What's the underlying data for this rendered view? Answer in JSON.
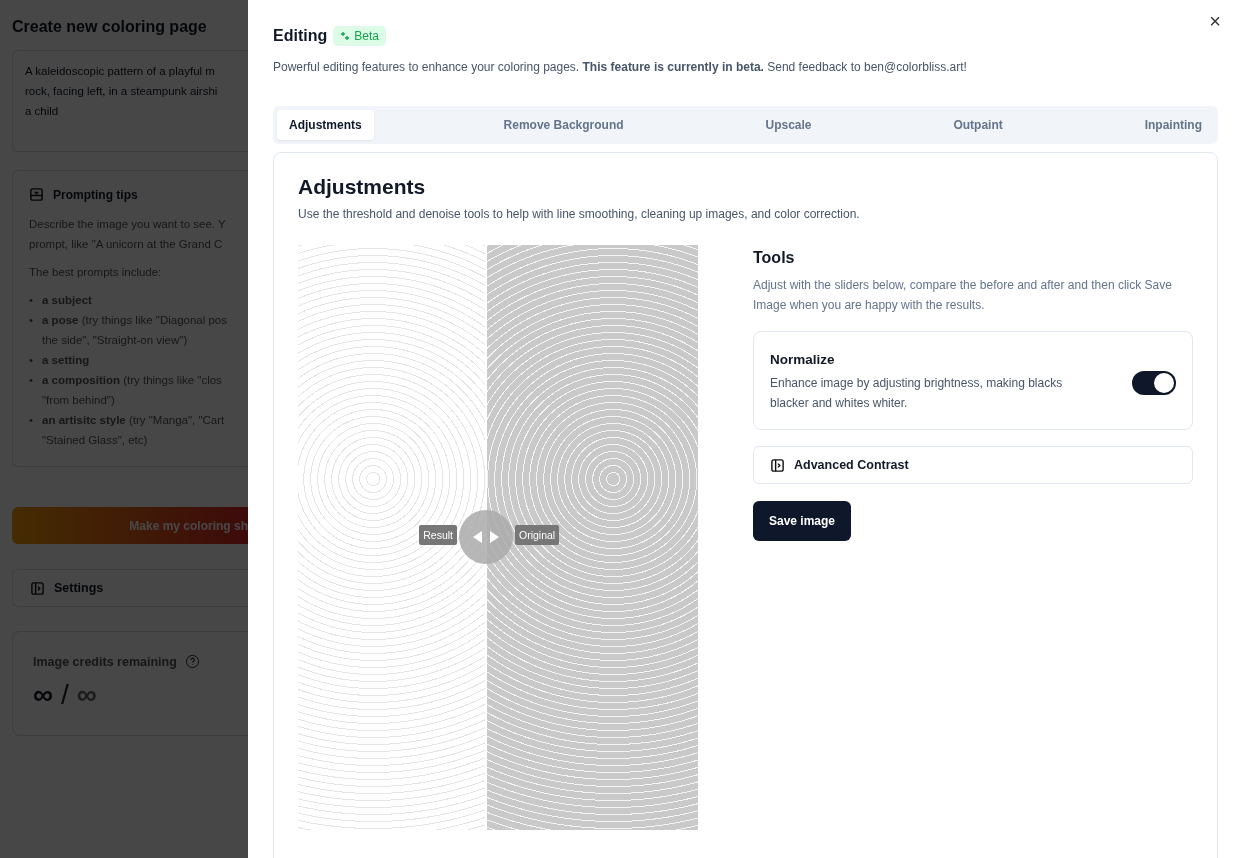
{
  "background_page": {
    "title": "Create new coloring page",
    "prompt": "A kaleidoscopic pattern of a playful m\nrock, facing left, in a steampunk airshi\na child",
    "tips": {
      "title": "Prompting tips",
      "paragraphs": [
        "Describe the image you want to see. Y\nprompt, like \"A unicorn at the Grand C",
        "The best prompts include:"
      ],
      "bullet": "•",
      "list": [
        "**a subject**",
        "**a pose** (try things like \"Diagonal pos\nthe side\", \"Straight-on view\")",
        "**a setting**",
        "**a composition** (try things like \"clos\n\"from behind\")",
        "**an artisitc style** (try \"Manga\", \"Cart\n\"Stained Glass\", etc)"
      ]
    },
    "make_button": "Make my coloring sh",
    "settings": "Settings",
    "credits": {
      "label": "Image credits remaining",
      "used": "∞",
      "separator": "/",
      "total": "∞"
    }
  },
  "drawer": {
    "title": "Editing",
    "badge": "Beta",
    "description": "Powerful editing features to enhance your coloring pages. **This feature is currently in beta.** Send feedback to ben@colorbliss.art!",
    "close": "×",
    "tabs": [
      {
        "label": "Adjustments",
        "selected": true
      },
      {
        "label": "Remove Background",
        "selected": false
      },
      {
        "label": "Upscale",
        "selected": false
      },
      {
        "label": "Outpaint",
        "selected": false
      },
      {
        "label": "Inpainting",
        "selected": false
      }
    ],
    "panel": {
      "title": "Adjustments",
      "description": "Use the threshold and denoise tools to help with line smoothing, cleaning up images, and color correction.",
      "compare": {
        "left_label": "Result",
        "right_label": "Original",
        "level": 0.47
      },
      "tools": {
        "title": "Tools",
        "description": "Adjust with the sliders below, compare the before and after and then click Save Image when you are happy with the results.",
        "normalize": {
          "title": "Normalize",
          "description": "Enhance image by adjusting brightness, making blacks blacker and whites whiter.",
          "on": true
        },
        "advanced": "Advanced Contrast",
        "save": "Save image"
      }
    }
  }
}
